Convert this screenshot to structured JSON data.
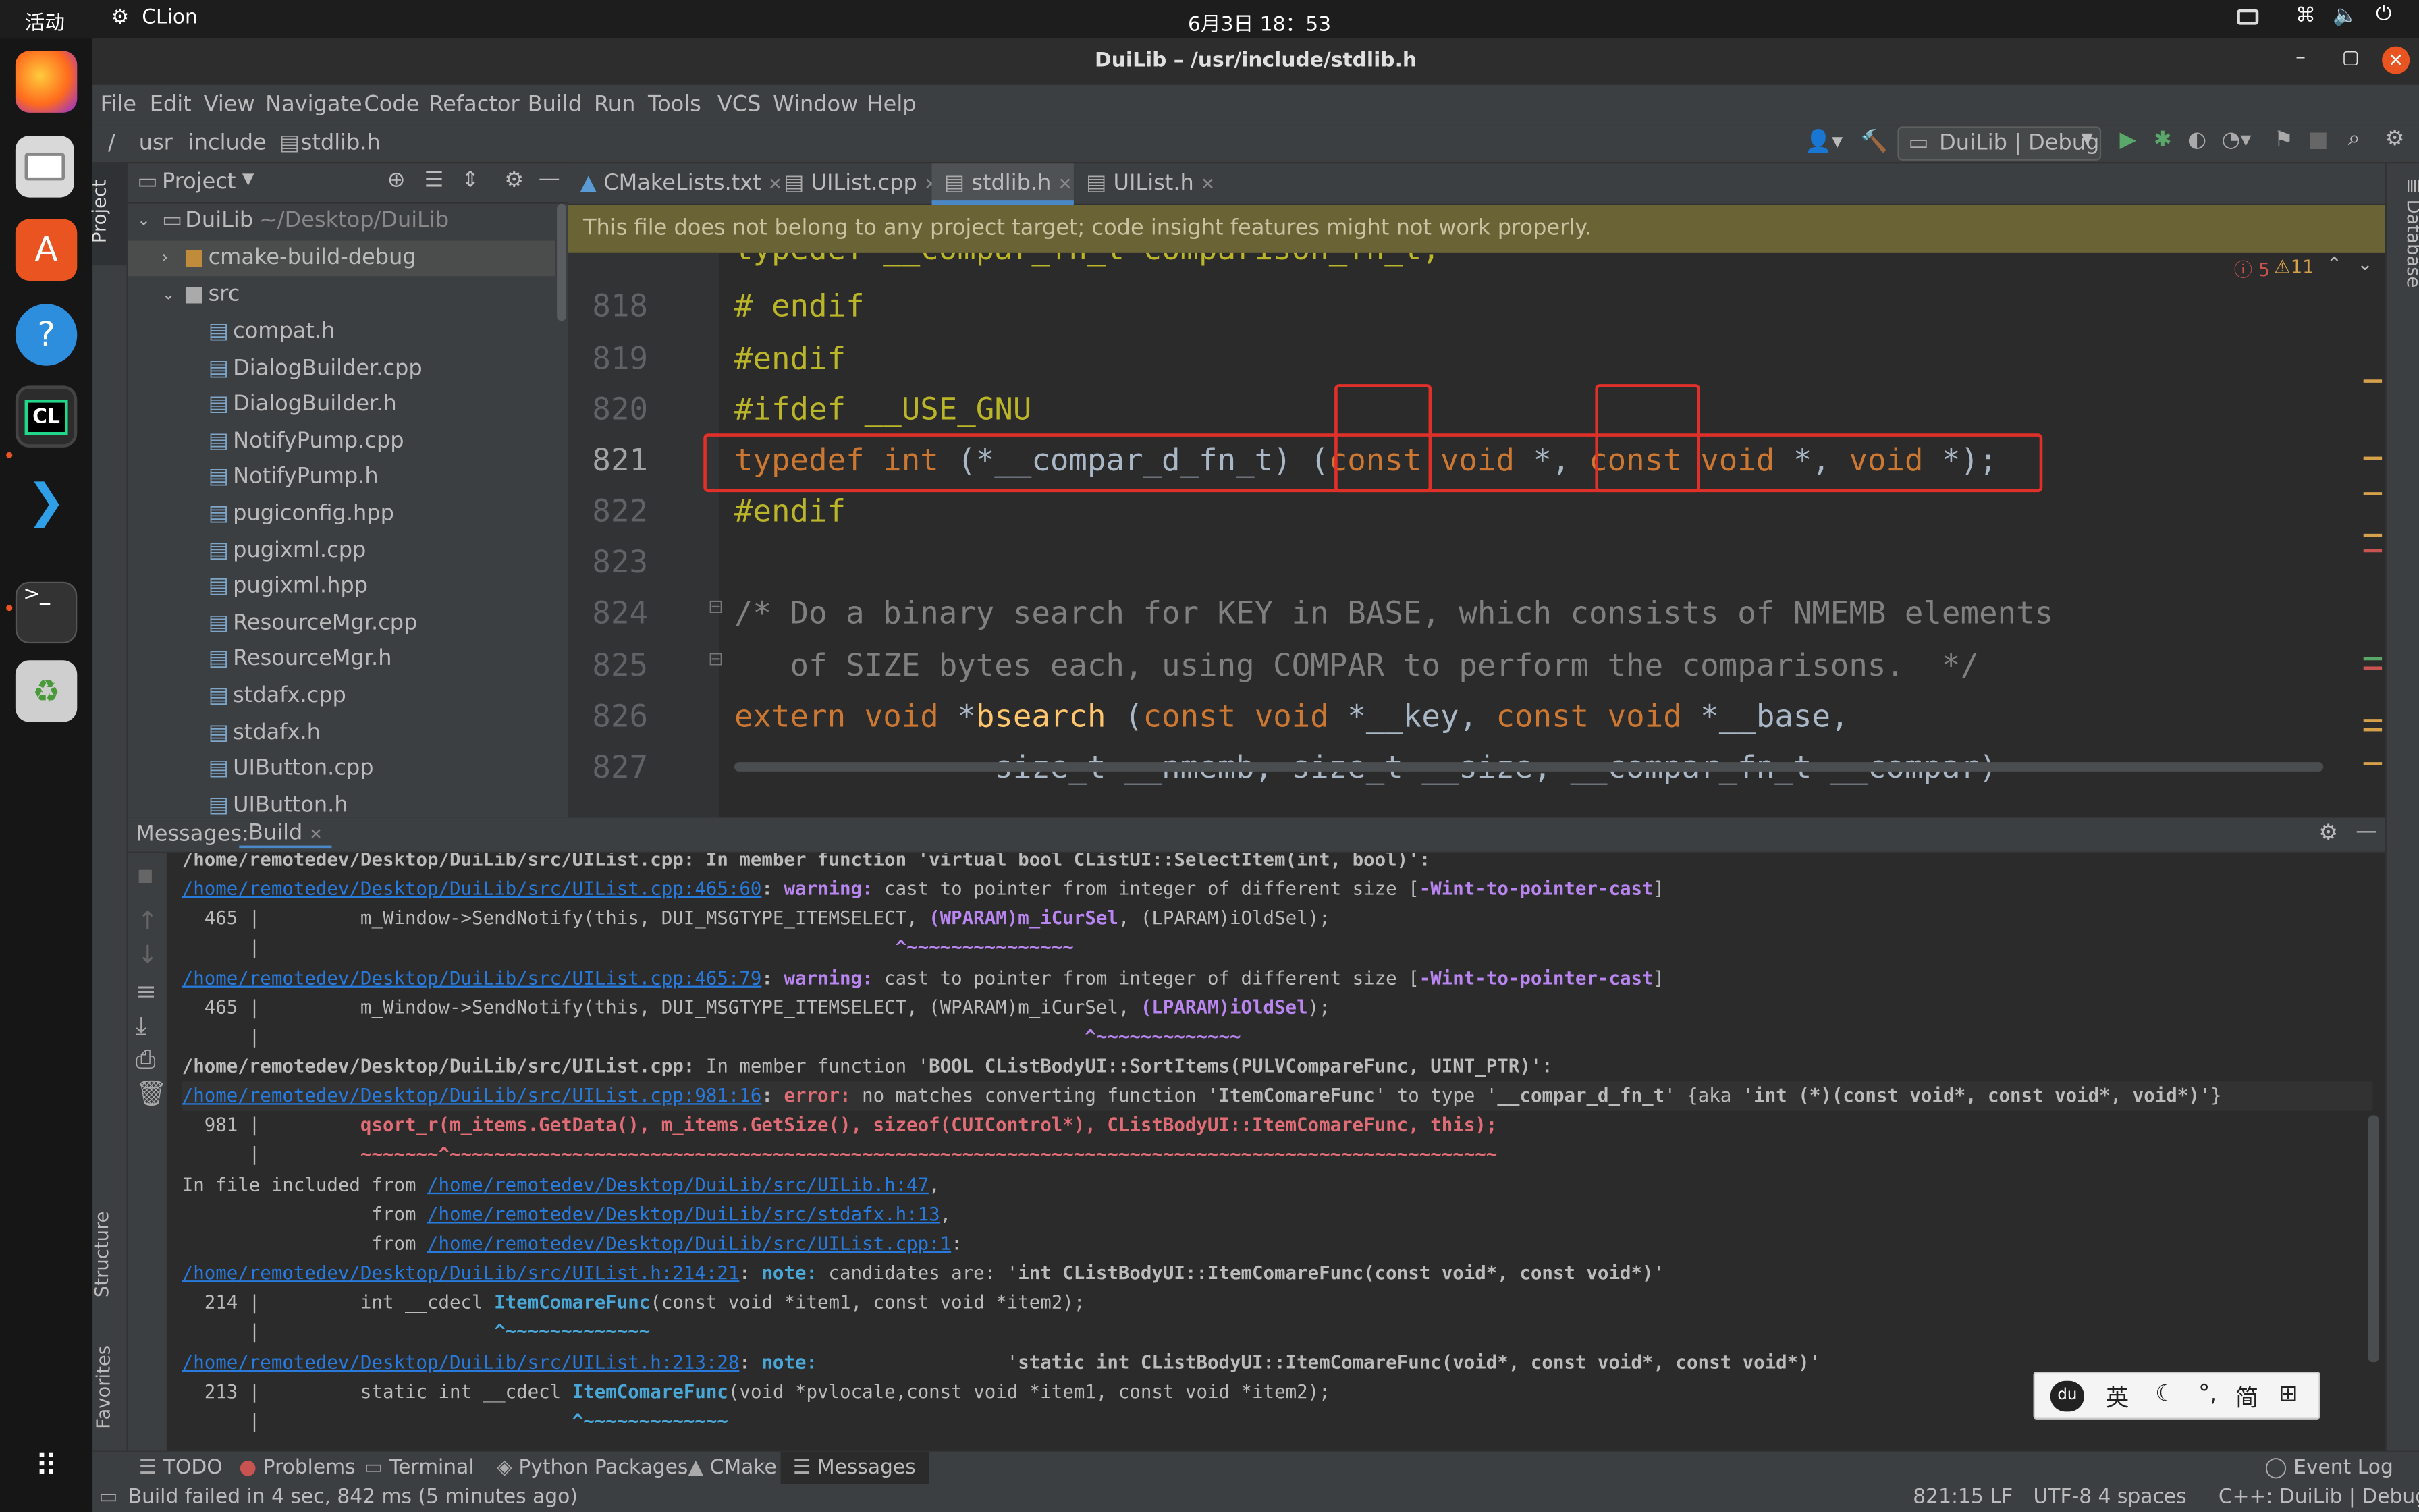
{
  "topbar": {
    "activities": "活动",
    "app": "CLion",
    "clock": "6月3日  18：53"
  },
  "window": {
    "title": "DuiLib – /usr/include/stdlib.h"
  },
  "menu": [
    "File",
    "Edit",
    "View",
    "Navigate",
    "Code",
    "Refactor",
    "Build",
    "Run",
    "Tools",
    "VCS",
    "Window",
    "Help"
  ],
  "breadcrumb": {
    "root": "/",
    "p1": "usr",
    "p2": "include",
    "p3": "stdlib.h"
  },
  "run_config": "DuiLib | Debug",
  "project": {
    "header": "Project",
    "root": "DuiLib",
    "root_path": "~/Desktop/DuiLib",
    "folder1": "cmake-build-debug",
    "folder2": "src",
    "files": [
      "compat.h",
      "DialogBuilder.cpp",
      "DialogBuilder.h",
      "NotifyPump.cpp",
      "NotifyPump.h",
      "pugiconfig.hpp",
      "pugixml.cpp",
      "pugixml.hpp",
      "ResourceMgr.cpp",
      "ResourceMgr.h",
      "stdafx.cpp",
      "stdafx.h",
      "UIButton.cpp",
      "UIButton.h"
    ]
  },
  "side": {
    "project": "Project",
    "structure": "Structure",
    "favorites": "Favorites",
    "database": "Database"
  },
  "tabs": [
    "CMakeLists.txt",
    "UIList.cpp",
    "stdlib.h",
    "UIList.h"
  ],
  "banner": "This file does not belong to any project target; code insight features might not work properly.",
  "inspections": {
    "errors": "5",
    "warnings": "11"
  },
  "code": {
    "l817": "typedef __compar_fn_t comparison_fn_t;",
    "n818": "818",
    "n819": "819",
    "n820": "820",
    "n821": "821",
    "n822": "822",
    "n823": "823",
    "n824": "824",
    "n825": "825",
    "n826": "826",
    "n827": "827",
    "l818": "# endif",
    "l819": "#endif",
    "l820a": "#ifdef ",
    "l820b": "__USE_GNU",
    "l821_typedef": "typedef ",
    "l821_int": "int ",
    "l821_name": "(*__compar_d_fn_t) (",
    "l821_c1": "const ",
    "l821_v1": "void ",
    "l821_s1": "*, ",
    "l821_c2": "const ",
    "l821_v2": "void ",
    "l821_s2": "*, ",
    "l821_v3": "void ",
    "l821_end": "*);",
    "l822": "#endif",
    "l824": "/* Do a binary search for KEY in BASE, which consists of NMEMB elements",
    "l825": "   of SIZE bytes each, using COMPAR to perform the comparisons.  */",
    "l826_extern": "extern ",
    "l826_void": "void ",
    "l826_star": "*",
    "l826_fn": "bsearch ",
    "l826_p": "(",
    "l826_c1": "const ",
    "l826_v1": "void ",
    "l826_a1": "*__key, ",
    "l826_c2": "const ",
    "l826_v2": "void ",
    "l826_a2": "*__base,",
    "l827": "              size_t __nmemb, size_t __size, __compar_fn_t __compar)"
  },
  "messages": {
    "label": "Messages:",
    "tab": "Build",
    "lines": {
      "l0": "/home/remotedev/Desktop/DuiLib/src/UIList.cpp: In member function 'virtual bool CListUI::SelectItem(int, bool)':",
      "l1_link": "/home/remotedev/Desktop/DuiLib/src/UIList.cpp:465:60",
      "l1_kind": "warning:",
      "l1_text": " cast to pointer from integer of different size [",
      "l1_flag": "-Wint-to-pointer-cast",
      "l1_end": "]",
      "l2_a": "  465 |         m_Window->SendNotify(this, DUI_MSGTYPE_ITEMSELECT, ",
      "l2_b": "(WPARAM)m_iCurSel",
      "l2_c": ", (LPARAM)iOldSel);",
      "l3_a": "      |                                                         ",
      "l3_b": "^~~~~~~~~~~~~~~~",
      "l4_link": "/home/remotedev/Desktop/DuiLib/src/UIList.cpp:465:79",
      "l4_kind": "warning:",
      "l4_text": " cast to pointer from integer of different size [",
      "l4_flag": "-Wint-to-pointer-cast",
      "l4_end": "]",
      "l5_a": "  465 |         m_Window->SendNotify(this, DUI_MSGTYPE_ITEMSELECT, (WPARAM)m_iCurSel, ",
      "l5_b": "(LPARAM)iOldSel",
      "l5_c": ");",
      "l6_a": "      |                                                                          ",
      "l6_b": "^~~~~~~~~~~~~~",
      "l7_a": "/home/remotedev/Desktop/DuiLib/src/UIList.cpp:",
      "l7_b": " In member function '",
      "l7_c": "BOOL CListBodyUI::SortItems(PULVCompareFunc, UINT_PTR)",
      "l7_d": "':",
      "l8_link": "/home/remotedev/Desktop/DuiLib/src/UIList.cpp:981:16",
      "l8_kind": "error:",
      "l8_text": " no matches converting function '",
      "l8_b1": "ItemComareFunc",
      "l8_t2": "' to type '",
      "l8_b2": "__compar_d_fn_t",
      "l8_t3": "' {aka '",
      "l8_b3": "int (*)(const void*, const void*, void*)",
      "l8_t4": "'}",
      "l9_a": "  981 |         ",
      "l9_b": "qsort_r(m_items.GetData(), m_items.GetSize(), sizeof(CUIControl*), CListBodyUI::ItemComareFunc, this);",
      "l10_a": "      |         ",
      "l10_b": "~~~~~~~^~~~~~~~~~~~~~~~~~~~~~~~~~~~~~~~~~~~~~~~~~~~~~~~~~~~~~~~~~~~~~~~~~~~~~~~~~~~~~~~~~~~~~~~~~~~~~~",
      "l11_a": "In file included from ",
      "l11_link": "/home/remotedev/Desktop/DuiLib/src/UILib.h:47",
      "l11_end": ",",
      "l12_a": "                 from ",
      "l12_link": "/home/remotedev/Desktop/DuiLib/src/stdafx.h:13",
      "l12_end": ",",
      "l13_a": "                 from ",
      "l13_link": "/home/remotedev/Desktop/DuiLib/src/UIList.cpp:1",
      "l13_end": ":",
      "l14_link": "/home/remotedev/Desktop/DuiLib/src/UIList.h:214:21",
      "l14_kind": "note:",
      "l14_text": " candidates are: '",
      "l14_b": "int CListBodyUI::ItemComareFunc(const void*, const void*)",
      "l14_end": "'",
      "l15_a": "  214 |         int __cdecl ",
      "l15_b": "ItemComareFunc",
      "l15_c": "(const void *item1, const void *item2);",
      "l16_a": "      |                     ",
      "l16_b": "^~~~~~~~~~~~~~",
      "l17_link": "/home/remotedev/Desktop/DuiLib/src/UIList.h:213:28",
      "l17_kind": "note:",
      "l17_text": "                 '",
      "l17_b": "static int CListBodyUI::ItemComareFunc(void*, const void*, const void*)",
      "l17_end": "'",
      "l18_a": "  213 |         static int __cdecl ",
      "l18_b": "ItemComareFunc",
      "l18_c": "(void *pvlocale,const void *item1, const void *item2);",
      "l19_a": "      |                            ",
      "l19_b": "^~~~~~~~~~~~~~"
    }
  },
  "bottom_tabs": [
    "TODO",
    "Problems",
    "Terminal",
    "Python Packages",
    "CMake",
    "Messages"
  ],
  "event_log": "Event Log",
  "status": {
    "text": "Build failed in 4 sec, 842 ms (5 minutes ago)",
    "pos": "821:15",
    "lf": "LF",
    "enc": "UTF-8",
    "indent": "4 spaces",
    "ctx": "C++: DuiLib | Debug"
  },
  "ime": {
    "a": "英",
    "b": "简"
  },
  "colors": {
    "keyword": "#cc7832",
    "macro": "#bbb529",
    "comment": "#808080",
    "function": "#ffc66d",
    "link": "#287bde",
    "highlight_box": "#e0302a"
  }
}
